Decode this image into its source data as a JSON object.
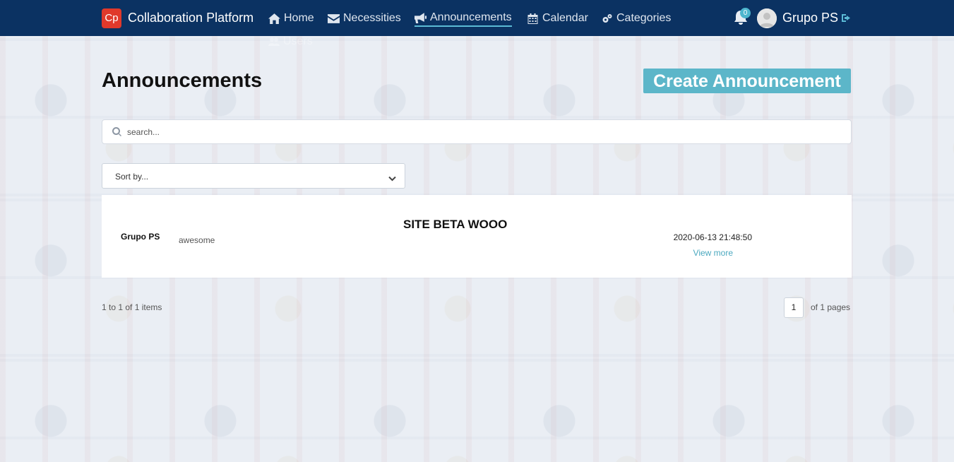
{
  "navbar": {
    "logo_text": "Cp",
    "brand": "Collaboration Platform",
    "items": [
      {
        "label": "Home",
        "icon": "home-icon"
      },
      {
        "label": "Necessities",
        "icon": "envelope-icon"
      },
      {
        "label": "Announcements",
        "icon": "megaphone-icon",
        "active": true
      },
      {
        "label": "Calendar",
        "icon": "calendar-icon"
      },
      {
        "label": "Categories",
        "icon": "cogs-icon"
      },
      {
        "label": "Users",
        "icon": "users-icon"
      }
    ],
    "notification_count": "0",
    "user_name": "Grupo PS",
    "accent_color": "#5bbad5",
    "bar_color": "#0b3262"
  },
  "page": {
    "title": "Announcements",
    "create_button": "Create Announcement",
    "search_placeholder": "search...",
    "sort_label": "Sort by..."
  },
  "announcements": [
    {
      "author": "Grupo PS",
      "description": "awesome",
      "title": "SITE BETA WOOO",
      "date": "2020-06-13 21:48:50",
      "link": "View more"
    }
  ],
  "pagination": {
    "items_summary": "1 to 1 of 1 items",
    "current_page": "1",
    "total_pages_label": "of 1 pages"
  }
}
